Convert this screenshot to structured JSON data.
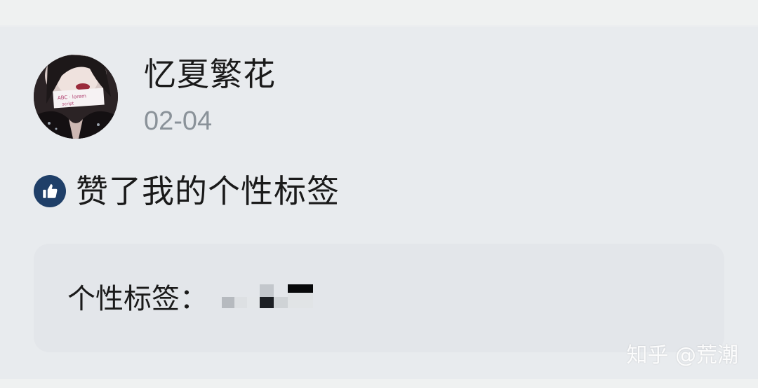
{
  "post": {
    "username": "忆夏繁花",
    "date": "02-04",
    "activity_text": "赞了我的个性标签",
    "activity_icon": "thumbs-up-icon",
    "accent_color": "#1f3f68"
  },
  "tag_card": {
    "label": "个性标签："
  },
  "watermark": "知乎 @荒潮"
}
